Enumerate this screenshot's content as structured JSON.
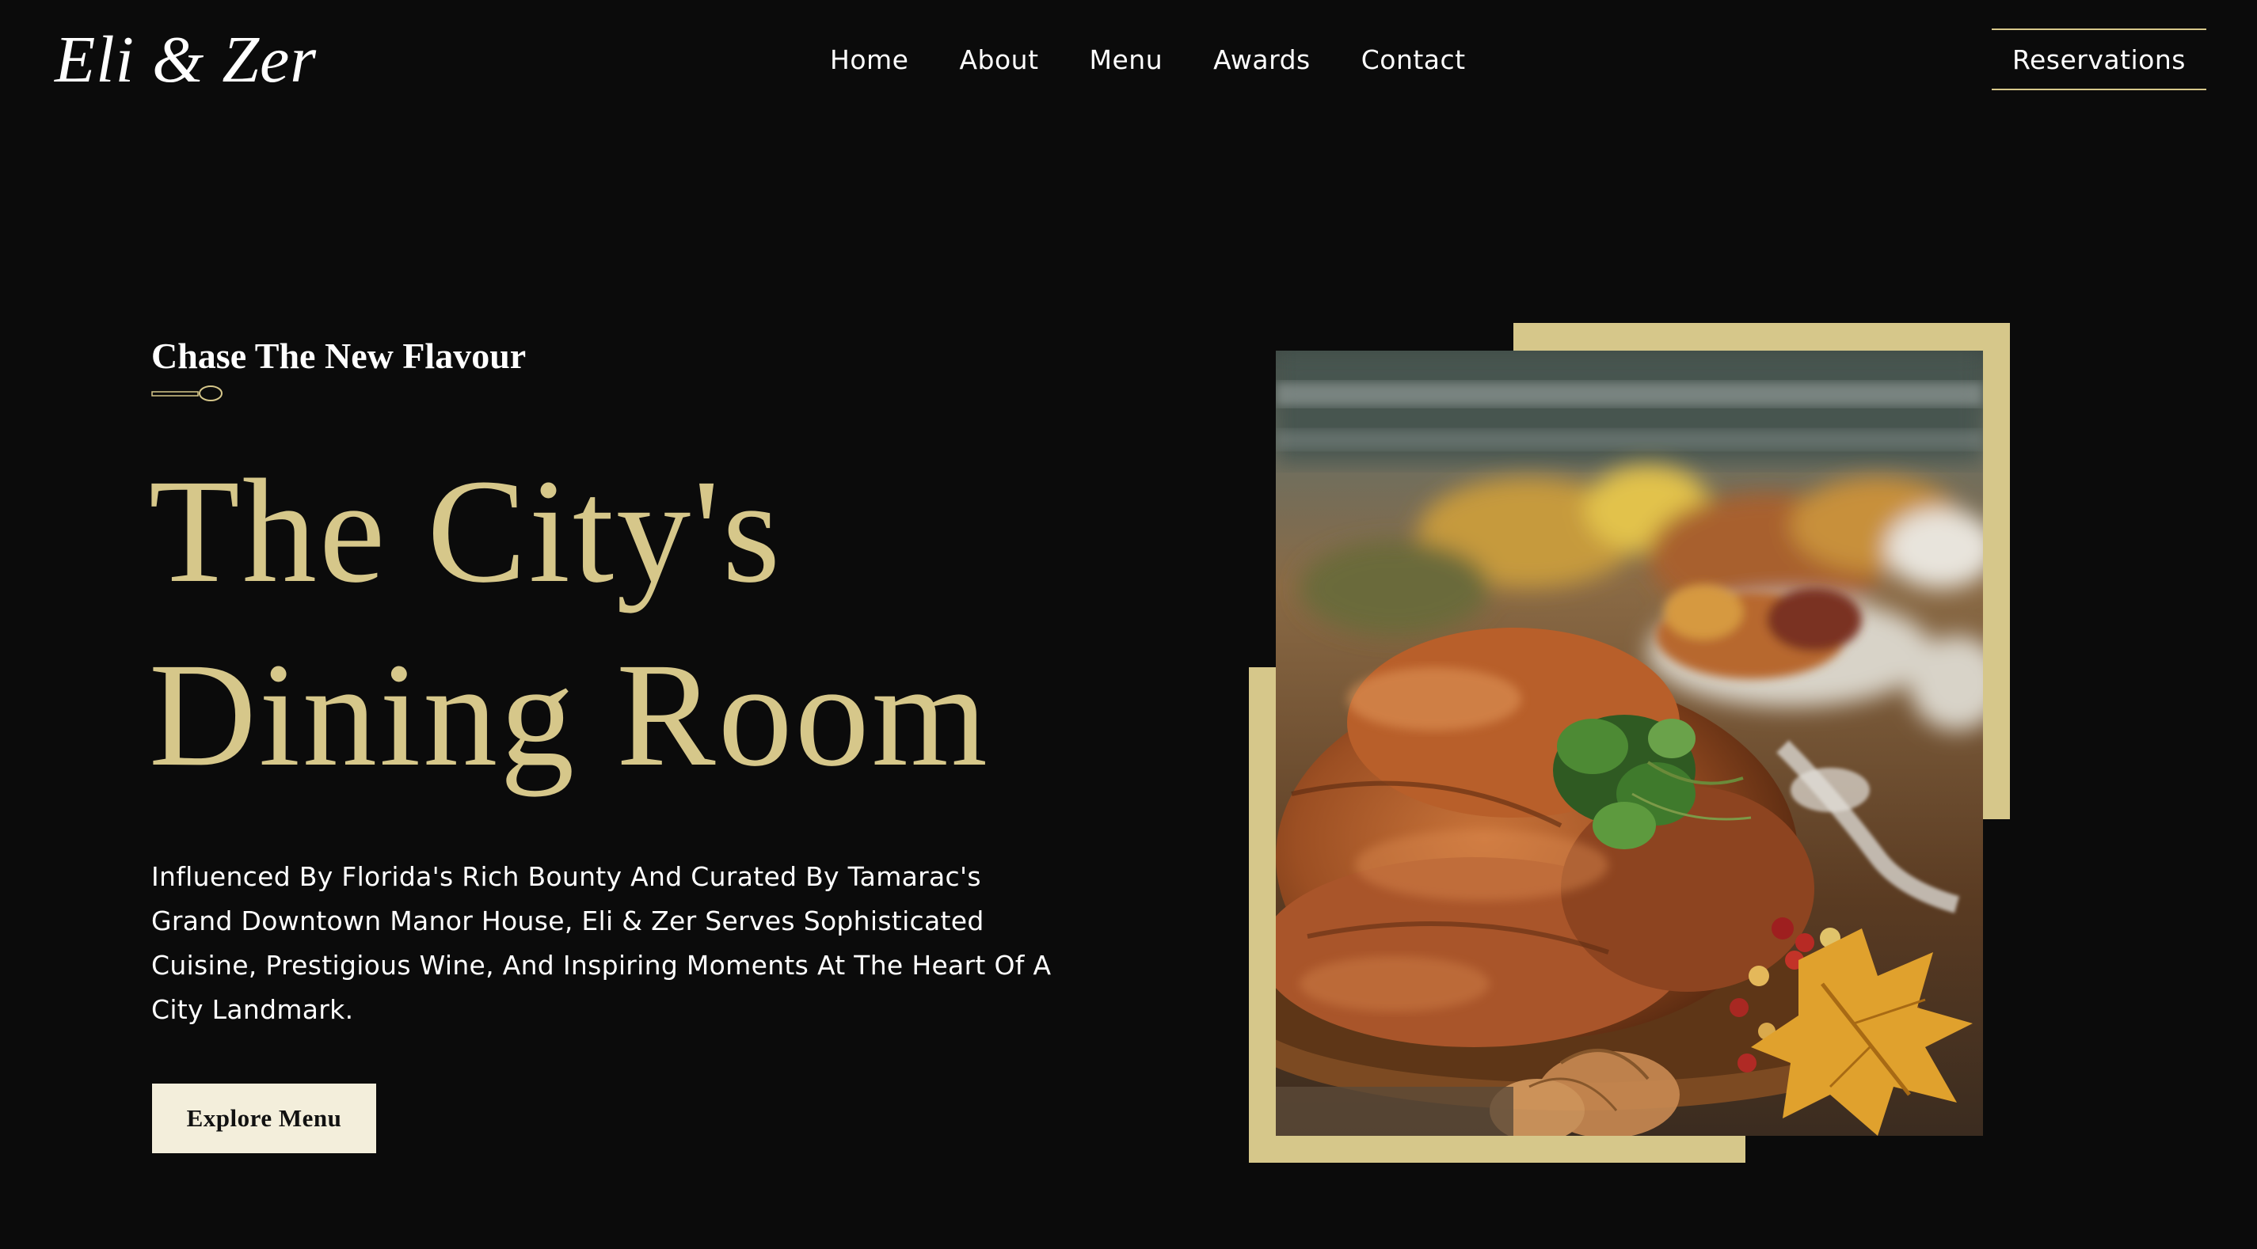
{
  "header": {
    "logo": "Eli & Zer",
    "nav": [
      "Home",
      "About",
      "Menu",
      "Awards",
      "Contact"
    ],
    "reservations_label": "Reservations"
  },
  "hero": {
    "eyebrow": "Chase The New Flavour",
    "headline_line1": "The City's",
    "headline_line2": "Dining Room",
    "description": "Influenced By Florida's Rich Bounty And Curated By Tamarac's Grand Downtown Manor House, Eli & Zer Serves Sophisticated Cuisine, Prestigious Wine, And Inspiring Moments At The Heart Of A City Landmark.",
    "cta_label": "Explore Menu"
  },
  "icons": {
    "divider": "spoon-icon",
    "image": "roast-chicken-photo"
  },
  "colors": {
    "background": "#0b0b0b",
    "accent_gold": "#d6c78a",
    "button_cream": "#f3eedb",
    "text": "#ffffff"
  }
}
